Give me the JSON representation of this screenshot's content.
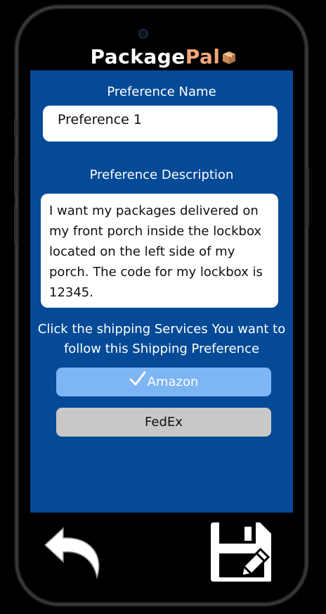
{
  "app": {
    "brand_part1": "Package",
    "brand_part2": "Pal",
    "brand_icon": "package-box-icon"
  },
  "form": {
    "name_label": "Preference Name",
    "name_value": "Preference 1",
    "description_label": "Preference Description",
    "description_value": "I want my packages delivered on my front porch inside the lockbox located on the left side of my porch. The code for my lockbox is 12345.",
    "instructions": "Click the shipping Services You want to follow this Shipping Preference"
  },
  "services": [
    {
      "label": "Amazon",
      "selected": true,
      "icon": "checkmark-icon"
    },
    {
      "label": "FedEx",
      "selected": false
    }
  ],
  "footer": {
    "back_icon": "back-arrow-icon",
    "save_icon": "save-edit-icon"
  },
  "colors": {
    "screen_bg": "#044a97",
    "brand_accent": "#f0a77a",
    "selected_service": "#7db5f5",
    "unselected_service": "#c8c8c8"
  }
}
